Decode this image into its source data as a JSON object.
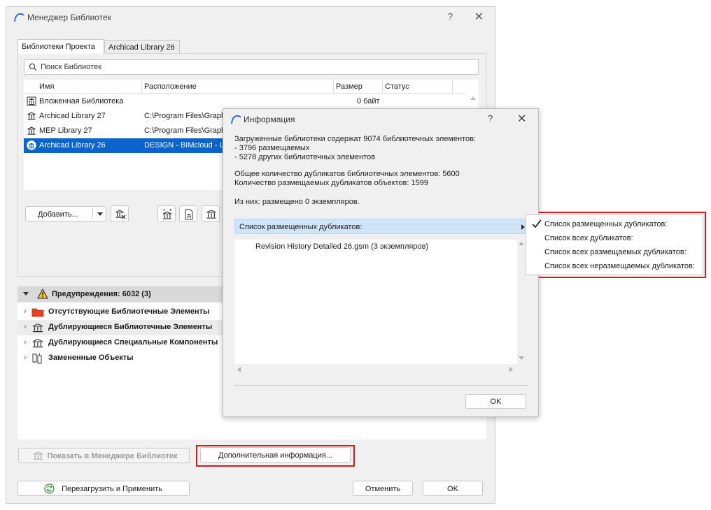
{
  "main_window": {
    "title": "Менеджер Библиотек",
    "help": "?",
    "close": "✕",
    "tabs": [
      "Библиотеки Проекта",
      "Archicad Library 26"
    ],
    "search_placeholder": "Поиск Библиотек",
    "columns": [
      "Имя",
      "Расположение",
      "Размер",
      "Статус"
    ],
    "rows": [
      {
        "name": "Вложенная Библиотека",
        "location": "",
        "size": "0 байт",
        "icon": "embedded-library-icon"
      },
      {
        "name": "Archicad Library 27",
        "location": "C:\\Program Files\\Graph",
        "size": "",
        "icon": "library-icon"
      },
      {
        "name": "MEP Library 27",
        "location": "C:\\Program Files\\Graph",
        "size": "",
        "icon": "library-icon"
      },
      {
        "name": "Archicad Library 26",
        "location": "DESIGN - BIMcloud - Li",
        "size": "",
        "icon": "bimcloud-library-icon"
      }
    ],
    "selected_row": 3,
    "add_button": "Добавить...",
    "warnings_header": "Предупреждения: 6032 (3)",
    "warnings": [
      {
        "label": "Отсутствующие Библиотечные Элементы",
        "icon": "folder-icon"
      },
      {
        "label": "Дублирующиеся Библиотечные Элементы",
        "icon": "library-icon"
      },
      {
        "label": "Дублирующиеся Специальные Компоненты",
        "icon": "library-icon"
      },
      {
        "label": "Замененные Объекты",
        "icon": "replaced-objects-icon"
      }
    ],
    "show_in_manager": "Показать в Менеджере Библиотек",
    "more_info": "Дополнительная информация...",
    "reload_apply": "Перезагрузить и Применить",
    "cancel": "Отменить",
    "ok": "OK"
  },
  "info_dialog": {
    "title": "Информация",
    "help": "?",
    "close": "✕",
    "lines": [
      "Загруженные библиотеки содержат 9074 библиотечных элементов:",
      "- 3796 размещаемых",
      "- 5278 других библиотечных элементов",
      "Общее количество дубликатов библиотечных элементов: 5600",
      "Количество размещаемых дубликатов объектов: 1599",
      "Из них: размещено 0 экземпляров."
    ],
    "dropdown_value": "Список размещенных дубликатов:",
    "list_items": [
      "Revision History Detailed 26.gsm (3 экземпляров)"
    ],
    "ok": "OK"
  },
  "dropdown_menu": {
    "items": [
      "Список размещенных дубликатов:",
      "Список всех дубликатов:",
      "Список всех размещаемых дубликатов:",
      "Список всех неразмещаемых дубликатов:"
    ],
    "checked_index": 0
  },
  "colors": {
    "selection": "#0a64cc",
    "highlight_box": "#e01717",
    "dropdown_bg": "#cfe3f7",
    "accent_green": "#2e9b3c"
  }
}
